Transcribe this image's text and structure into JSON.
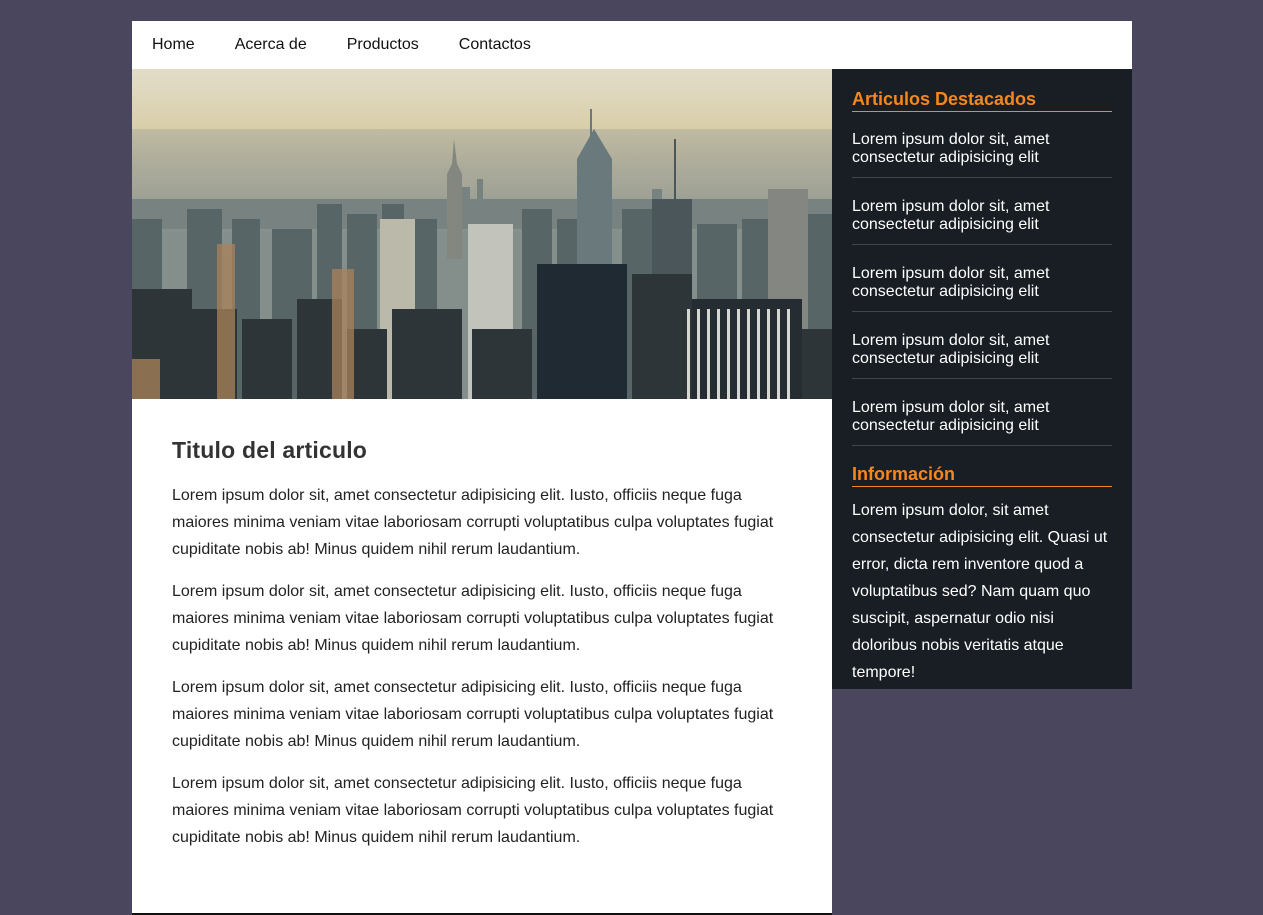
{
  "nav": {
    "items": [
      "Home",
      "Acerca de",
      "Productos",
      "Contactos"
    ]
  },
  "hero": {
    "description": ""
  },
  "article": {
    "title": "Titulo del articulo",
    "paragraphs": [
      "Lorem ipsum dolor sit, amet consectetur adipisicing elit. Iusto, officiis neque fuga maiores minima veniam vitae laboriosam corrupti voluptatibus culpa voluptates fugiat cupiditate nobis ab! Minus quidem nihil rerum laudantium.",
      "Lorem ipsum dolor sit, amet consectetur adipisicing elit. Iusto, officiis neque fuga maiores minima veniam vitae laboriosam corrupti voluptatibus culpa voluptates fugiat cupiditate nobis ab! Minus quidem nihil rerum laudantium.",
      "Lorem ipsum dolor sit, amet consectetur adipisicing elit. Iusto, officiis neque fuga maiores minima veniam vitae laboriosam corrupti voluptatibus culpa voluptates fugiat cupiditate nobis ab! Minus quidem nihil rerum laudantium.",
      "Lorem ipsum dolor sit, amet consectetur adipisicing elit. Iusto, officiis neque fuga maiores minima veniam vitae laboriosam corrupti voluptatibus culpa voluptates fugiat cupiditate nobis ab! Minus quidem nihil rerum laudantium."
    ]
  },
  "sidebar": {
    "featured_title": "Articulos Destacados",
    "featured_items": [
      "Lorem ipsum dolor sit, amet consectetur adipisicing elit",
      "Lorem ipsum dolor sit, amet consectetur adipisicing elit",
      "Lorem ipsum dolor sit, amet consectetur adipisicing elit",
      "Lorem ipsum dolor sit, amet consectetur adipisicing elit",
      "Lorem ipsum dolor sit, amet consectetur adipisicing elit"
    ],
    "info_title": "Información",
    "info_text": "Lorem ipsum dolor, sit amet consectetur adipisicing elit. Quasi ut error, dicta rem inventore quod a voluptatibus sed? Nam quam quo suscipit, aspernatur odio nisi doloribus nobis veritatis atque tempore!"
  },
  "colors": {
    "page_background": "#4a465e",
    "sidebar_background": "#181e24",
    "accent": "#f7861b"
  }
}
